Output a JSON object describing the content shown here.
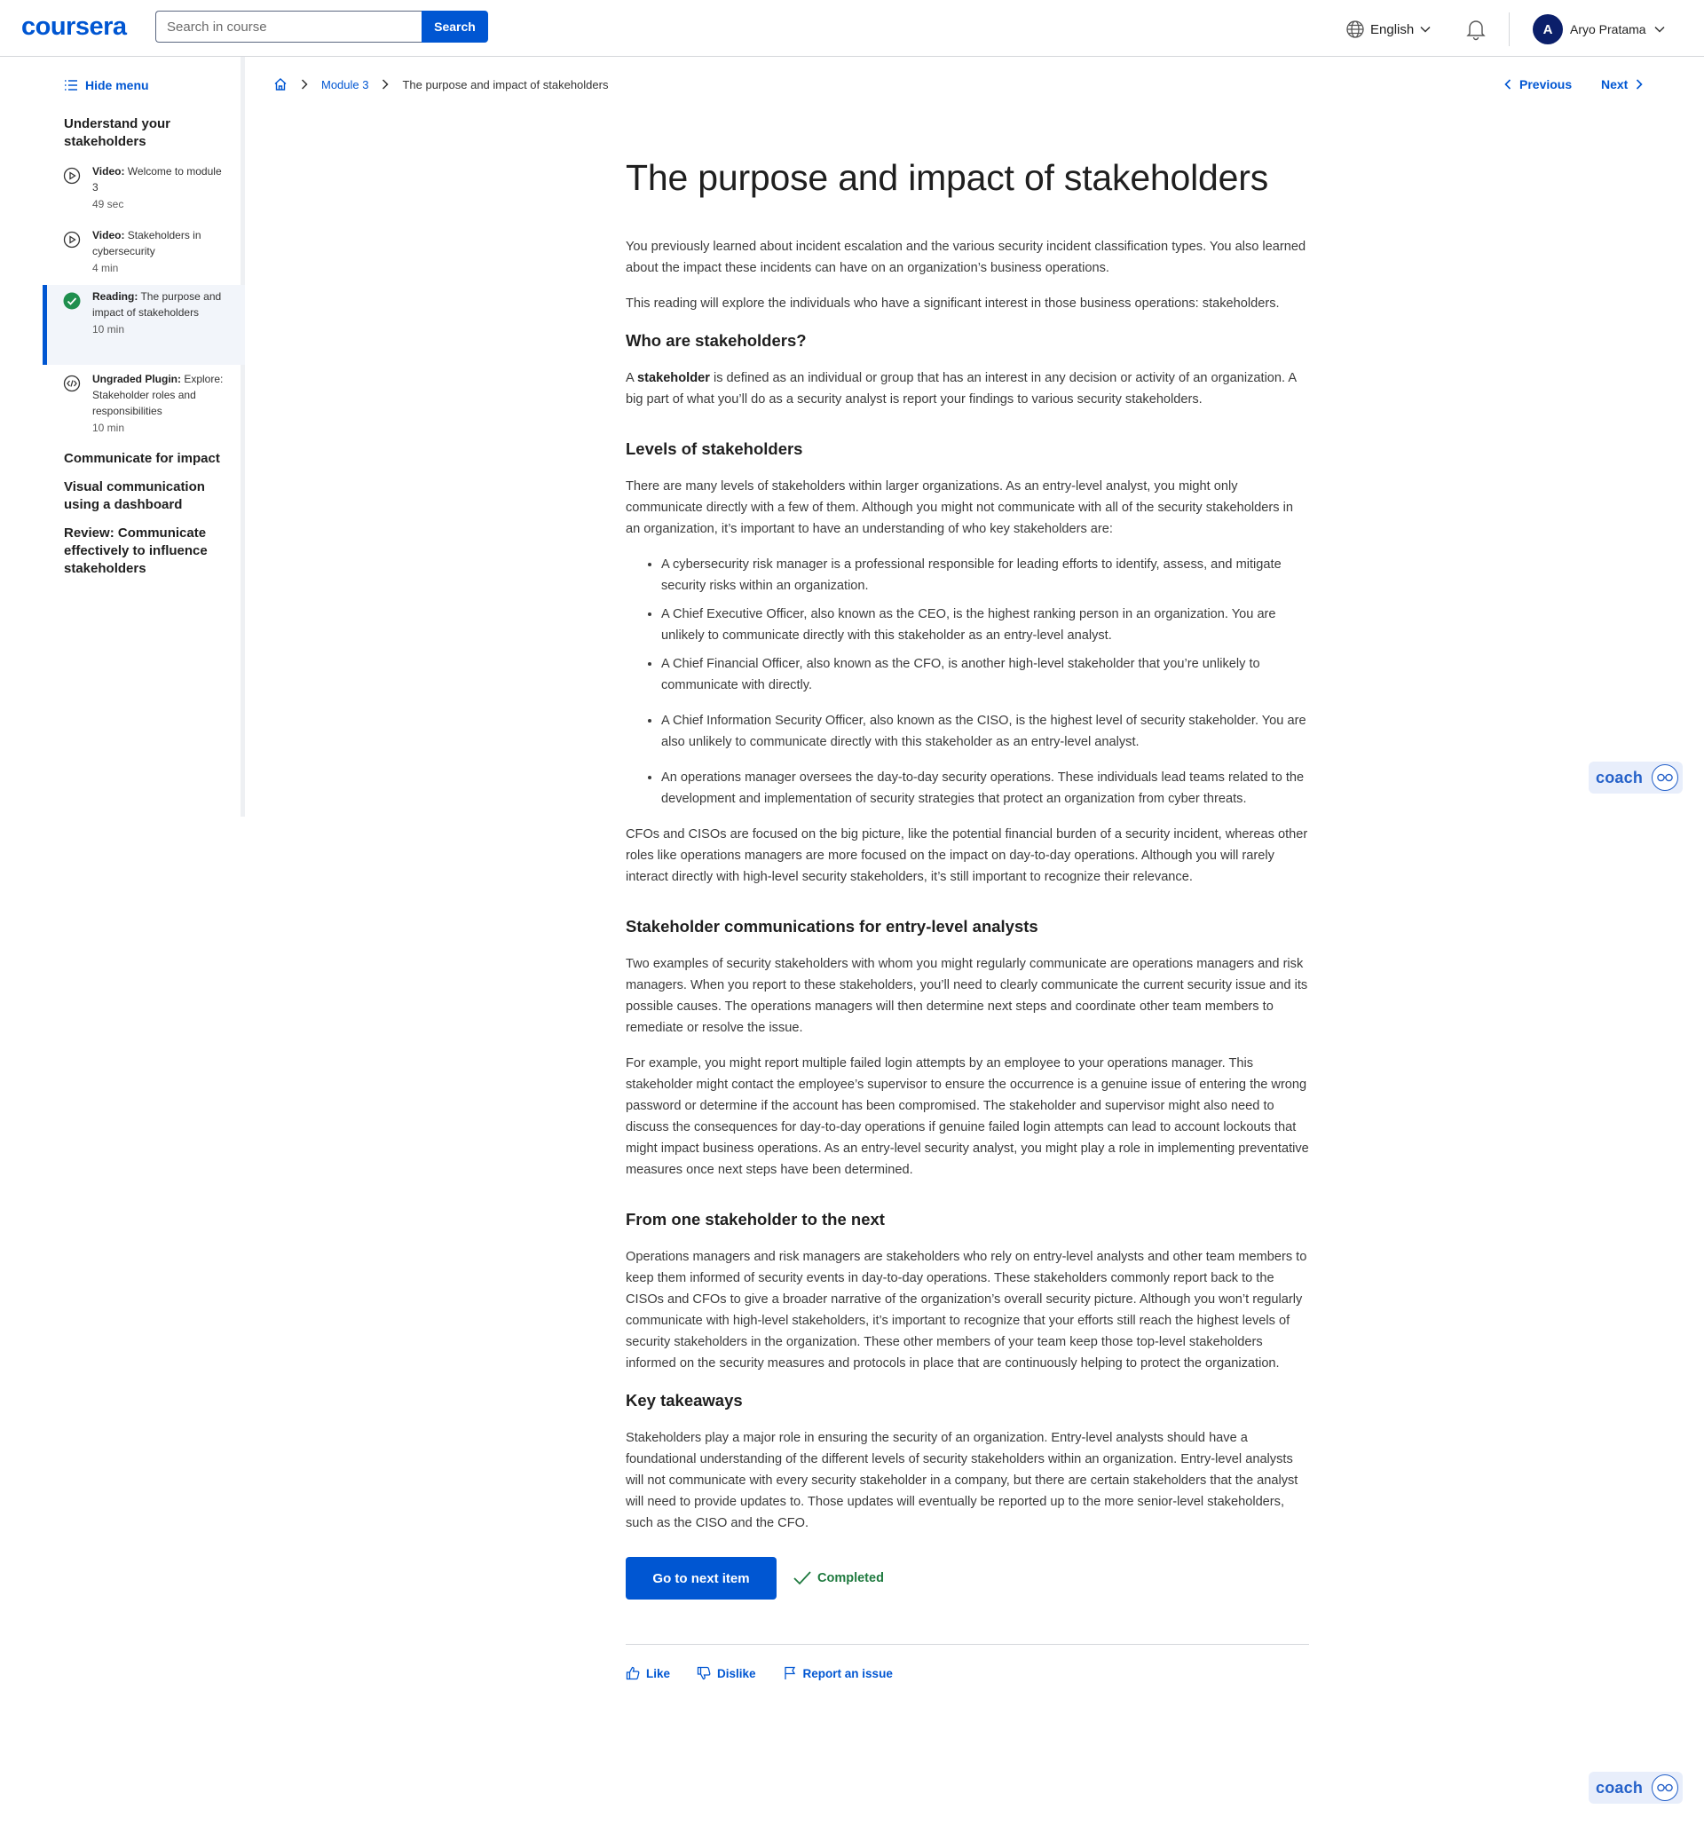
{
  "header": {
    "logo": "coursera",
    "search_placeholder": "Search in course",
    "search_button": "Search",
    "language": "English",
    "avatar_initial": "A",
    "user_name": "Aryo Pratama"
  },
  "sidebar": {
    "hide_menu": "Hide menu",
    "section_1": "Understand your stakeholders",
    "lessons": [
      {
        "type": "Video:",
        "title": " Welcome to module 3",
        "duration": "49 sec",
        "icon": "play-icon"
      },
      {
        "type": "Video:",
        "title": " Stakeholders in cybersecurity",
        "duration": "4 min",
        "icon": "play-icon"
      },
      {
        "type": "Reading:",
        "title": " The purpose and impact of stakeholders",
        "duration": "10 min",
        "icon": "check-circle-icon"
      },
      {
        "type": "Ungraded Plugin:",
        "title": " Explore: Stakeholder roles and responsibilities",
        "duration": "10 min",
        "icon": "code-icon"
      }
    ],
    "section_2": "Communicate for impact",
    "section_3": "Visual communication using a dashboard",
    "section_4": "Review: Communicate effectively to influence stakeholders"
  },
  "breadcrumb": {
    "module": "Module 3",
    "current": "The purpose and impact of stakeholders"
  },
  "nav": {
    "previous": "Previous",
    "next": "Next"
  },
  "article": {
    "title": "The purpose and impact of stakeholders",
    "intro_1": "You previously learned about incident escalation and the various security incident classification types. You also learned about the impact these incidents can have on an organization’s business operations.",
    "intro_2": "This reading will explore the individuals who have a significant interest in those business operations: stakeholders.",
    "h_who": "Who are stakeholders?",
    "who_a": "A ",
    "who_term": "stakeholder",
    "who_rest": " is defined as an individual or group that has an interest in any decision or activity of an organization. A big part of what you’ll do as a security analyst is report your findings to various security stakeholders.",
    "h_levels": "Levels of stakeholders",
    "levels_p": "There are many levels of stakeholders within larger organizations. As an entry-level analyst, you might only communicate directly with a few of them. Although you might not communicate with all of the security stakeholders in an organization, it’s important to have an understanding of who key stakeholders are:",
    "bullets": [
      "A cybersecurity risk manager is a professional responsible for leading efforts to identify, assess, and mitigate security risks within an organization.",
      "A Chief Executive Officer, also known as the CEO, is the highest ranking person in an organization. You are unlikely to communicate directly with this stakeholder as an entry-level analyst.",
      "A Chief Financial Officer, also known as the CFO, is another high-level stakeholder that you’re unlikely to communicate with directly.",
      "A Chief Information Security Officer, also known as the CISO, is the highest level of security stakeholder. You are also unlikely to communicate directly with this stakeholder as an entry-level analyst.",
      "An operations manager oversees the day-to-day security operations. These individuals lead teams related to the development and implementation of security strategies that protect an organization from cyber threats."
    ],
    "levels_after": "CFOs and CISOs are focused on the big picture, like the potential financial burden of a security incident, whereas other roles like operations managers are more focused on the impact on day-to-day operations. Although you will rarely interact directly with high-level security stakeholders, it’s still important to recognize their relevance.",
    "h_comms": "Stakeholder communications for entry-level analysts",
    "comms_1": "Two examples of security stakeholders with whom you might regularly communicate are operations managers and risk managers. When you report to these stakeholders, you’ll need to clearly communicate the current security issue and its possible causes. The operations managers will then determine next steps and coordinate other team members to remediate or resolve the issue.",
    "comms_2": "For example, you might report multiple failed login attempts by an employee to your operations manager. This stakeholder might contact the employee’s supervisor to ensure the occurrence is a genuine issue of entering the wrong password or determine if the account has been compromised. The stakeholder and supervisor might also need to discuss the consequences for day-to-day operations if genuine failed login attempts can lead to account lockouts that might impact business operations. As an entry-level security analyst, you might play a role in implementing preventative measures once next steps have been determined.",
    "h_next": "From one stakeholder to the next",
    "next_p": "Operations managers and risk managers are stakeholders who rely on entry-level analysts and other team members to keep them informed of security events in day-to-day operations. These stakeholders commonly report back to the CISOs and CFOs to give a broader narrative of the organization’s overall security picture. Although you won’t regularly communicate with high-level stakeholders, it’s important to recognize that your efforts still reach the highest levels of security stakeholders in the organization. These other members of your team keep those top-level stakeholders informed on the security measures and protocols in place that are continuously helping to protect the organization.",
    "h_key": "Key takeaways",
    "key_p": "Stakeholders play a major role in ensuring the security of an organization. Entry-level analysts should have a foundational understanding of the different levels of security stakeholders within an organization. Entry-level analysts will not communicate with every security stakeholder in a company, but there are certain stakeholders that the analyst will need to provide updates to. Those updates will eventually be reported up to the more senior-level stakeholders, such as the CISO and the CFO."
  },
  "actions": {
    "next_item": "Go to next item",
    "completed": "Completed"
  },
  "feedback": {
    "like": "Like",
    "dislike": "Dislike",
    "report": "Report an issue"
  },
  "coach": {
    "label": "coach"
  },
  "colors": {
    "brand": "#0056d2",
    "completed": "#1f7a3f",
    "coach_bg": "#e8eefb"
  }
}
